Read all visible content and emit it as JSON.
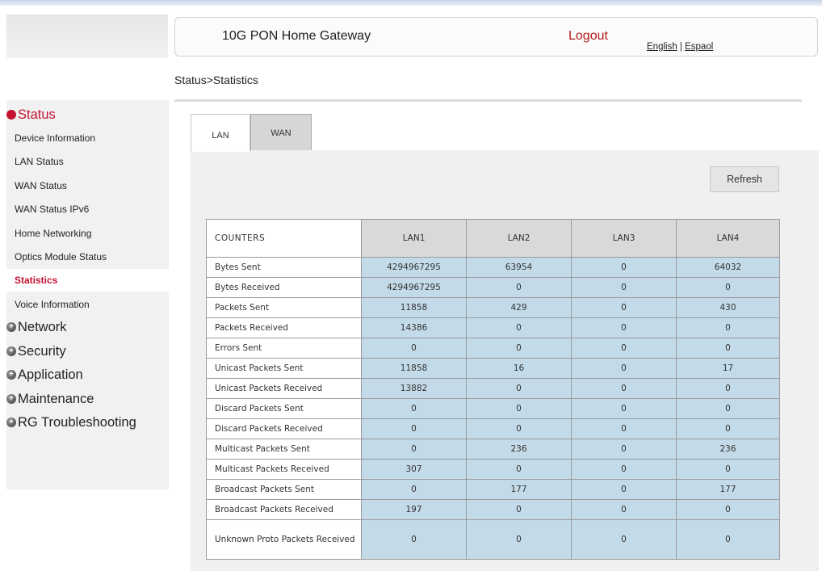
{
  "header": {
    "app_title": "10G PON Home Gateway",
    "logout": "Logout",
    "lang_english": "English",
    "lang_sep": " | ",
    "lang_spanish": "Espaol"
  },
  "breadcrumb": "Status>Statistics",
  "sidebar": {
    "status_group": "Status",
    "status_items": [
      "Device Information",
      "LAN Status",
      "WAN Status",
      "WAN Status IPv6",
      "Home Networking",
      "Optics Module Status",
      "Statistics",
      "Voice Information"
    ],
    "selected_item": "Statistics",
    "other_groups": [
      "Network",
      "Security",
      "Application",
      "Maintenance",
      "RG Troubleshooting"
    ]
  },
  "tabs": {
    "lan": "LAN",
    "wan": "WAN",
    "active": "LAN"
  },
  "refresh_label": "Refresh",
  "table": {
    "headers": [
      "COUNTERS",
      "LAN1",
      "LAN2",
      "LAN3",
      "LAN4"
    ],
    "rows": [
      [
        "Bytes Sent",
        "4294967295",
        "63954",
        "0",
        "64032"
      ],
      [
        "Bytes Received",
        "4294967295",
        "0",
        "0",
        "0"
      ],
      [
        "Packets Sent",
        "11858",
        "429",
        "0",
        "430"
      ],
      [
        "Packets Received",
        "14386",
        "0",
        "0",
        "0"
      ],
      [
        "Errors Sent",
        "0",
        "0",
        "0",
        "0"
      ],
      [
        "Unicast Packets Sent",
        "11858",
        "16",
        "0",
        "17"
      ],
      [
        "Unicast Packets Received",
        "13882",
        "0",
        "0",
        "0"
      ],
      [
        "Discard Packets Sent",
        "0",
        "0",
        "0",
        "0"
      ],
      [
        "Discard Packets Received",
        "0",
        "0",
        "0",
        "0"
      ],
      [
        "Multicast Packets Sent",
        "0",
        "236",
        "0",
        "236"
      ],
      [
        "Multicast Packets Received",
        "307",
        "0",
        "0",
        "0"
      ],
      [
        "Broadcast Packets Sent",
        "0",
        "177",
        "0",
        "177"
      ],
      [
        "Broadcast Packets Received",
        "197",
        "0",
        "0",
        "0"
      ],
      [
        "Unknown Proto Packets Received",
        "0",
        "0",
        "0",
        "0"
      ]
    ]
  },
  "colors": {
    "accent_red": "#c4122f",
    "value_cell_bg": "#c3dbe8",
    "header_cell_bg": "#d9d9d9",
    "panel_bg": "#f0f0f0"
  },
  "icons": {
    "expanded_group": "minus-circle-icon",
    "collapsed_group": "plus-circle-icon"
  }
}
